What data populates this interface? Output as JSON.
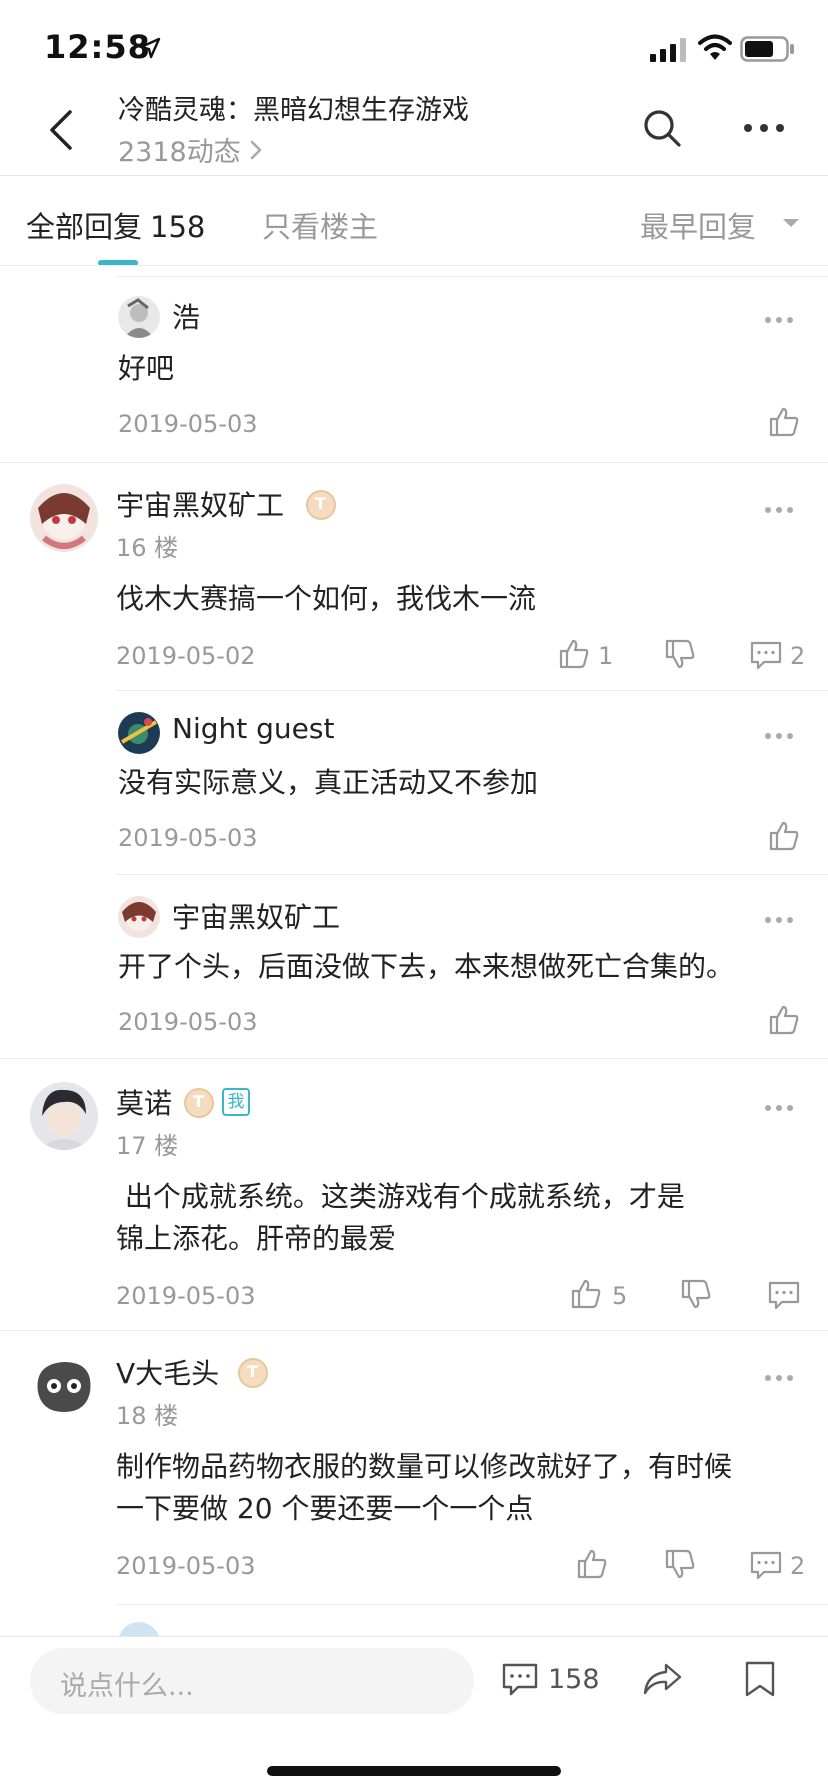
{
  "status_bar": {
    "time": "12:58"
  },
  "nav": {
    "title": "冷酷灵魂：黑暗幻想生存游戏",
    "subtitle": "2318动态"
  },
  "tabs": {
    "all_label": "全部回复",
    "all_count": "158",
    "op_only": "只看楼主",
    "sort": "最早回复"
  },
  "replies": [
    {
      "name": "浩",
      "text": "好吧",
      "date": "2019-05-03"
    }
  ],
  "floor16": {
    "name": "宇宙黑奴矿工",
    "floor": "16 楼",
    "text": "伐木大赛搞一个如何，我伐木一流",
    "date": "2019-05-02",
    "likes": "1",
    "comments": "2",
    "subreplies": [
      {
        "name": "Night guest",
        "text": "没有实际意义，真正活动又不参加",
        "date": "2019-05-03"
      },
      {
        "name": "宇宙黑奴矿工",
        "text": "开了个头，后面没做下去，本来想做死亡合集的。",
        "date": "2019-05-03"
      }
    ]
  },
  "floor17": {
    "name": "莫诺",
    "me_badge": "我",
    "floor": "17 楼",
    "text_line1": " 出个成就系统。这类游戏有个成就系统，才是",
    "text_line2": "锦上添花。肝帝的最爱",
    "date": "2019-05-03",
    "likes": "5"
  },
  "floor18": {
    "name": "V大毛头",
    "floor": "18 楼",
    "text_line1": "制作物品药物衣服的数量可以修改就好了，有时候",
    "text_line2": "一下要做 20 个要还要一个一个点",
    "date": "2019-05-03",
    "comments": "2"
  },
  "bottom_bar": {
    "input_placeholder": "说点什么...",
    "comment_count": "158"
  },
  "badge_letter": "T",
  "colors": {
    "accent": "#3ab6c6",
    "muted": "#999999",
    "text": "#222222"
  }
}
